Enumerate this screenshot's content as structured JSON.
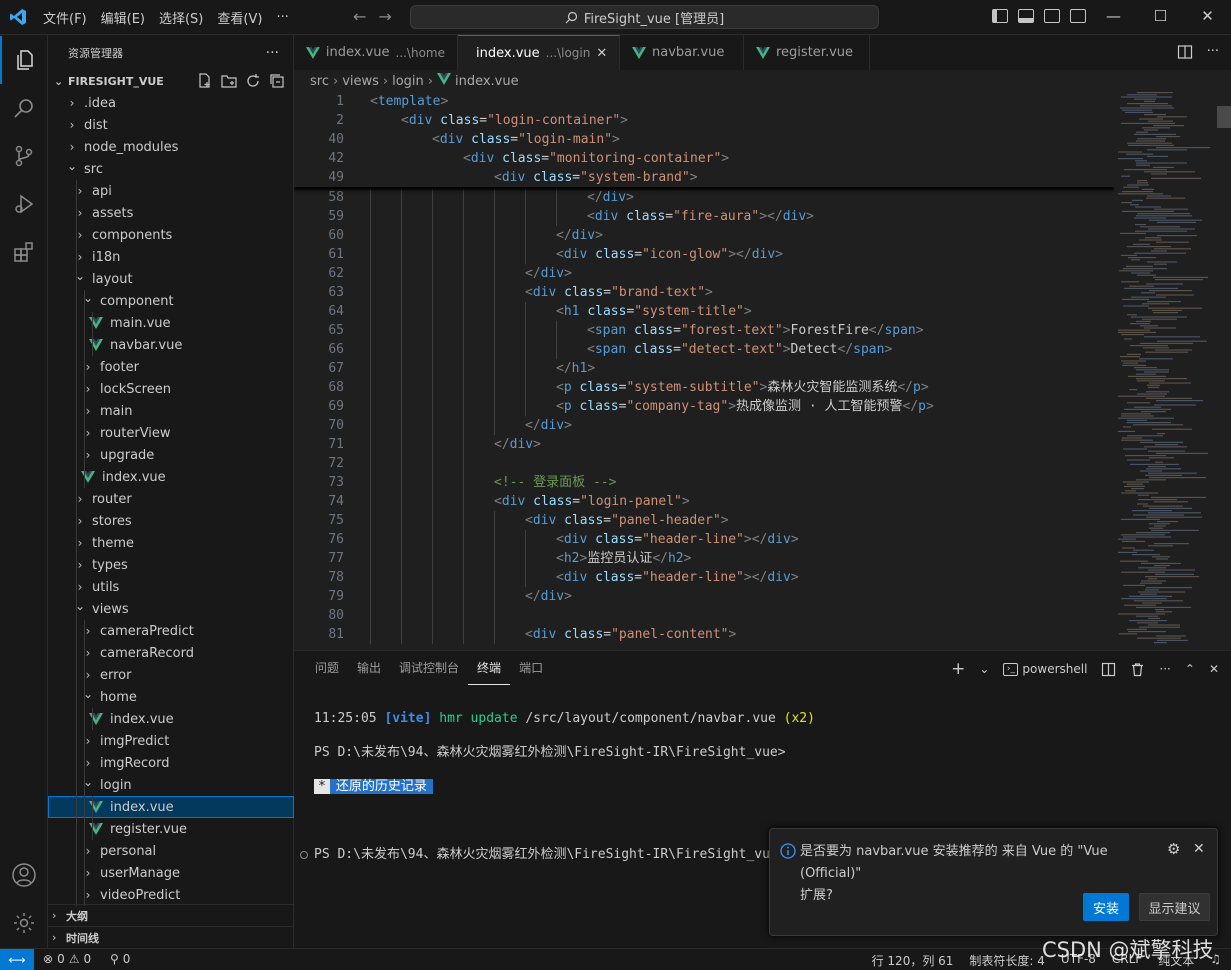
{
  "menu": [
    "文件(F)",
    "编辑(E)",
    "选择(S)",
    "查看(V)",
    "···"
  ],
  "command_center": "FireSight_vue [管理员]",
  "colors": {
    "accent": "#0078d4",
    "vue_green": "#41b883",
    "tag": "#569cd6",
    "attr": "#9cdcfe",
    "string": "#ce9178",
    "comment": "#6a9955"
  },
  "activity_icons": [
    "files-icon",
    "search-icon",
    "source-control-icon",
    "run-debug-icon",
    "extensions-icon",
    "account-icon",
    "settings-gear-icon"
  ],
  "sidebar": {
    "title": "资源管理器",
    "project": "FIRESIGHT_VUE",
    "tree": [
      {
        "label": ".idea",
        "depth": 0,
        "type": "folder",
        "open": false
      },
      {
        "label": "dist",
        "depth": 0,
        "type": "folder",
        "open": false
      },
      {
        "label": "node_modules",
        "depth": 0,
        "type": "folder",
        "open": false
      },
      {
        "label": "src",
        "depth": 0,
        "type": "folder",
        "open": true
      },
      {
        "label": "api",
        "depth": 1,
        "type": "folder",
        "open": false
      },
      {
        "label": "assets",
        "depth": 1,
        "type": "folder",
        "open": false
      },
      {
        "label": "components",
        "depth": 1,
        "type": "folder",
        "open": false
      },
      {
        "label": "i18n",
        "depth": 1,
        "type": "folder",
        "open": false
      },
      {
        "label": "layout",
        "depth": 1,
        "type": "folder",
        "open": true
      },
      {
        "label": "component",
        "depth": 2,
        "type": "folder",
        "open": true
      },
      {
        "label": "main.vue",
        "depth": 3,
        "type": "vue"
      },
      {
        "label": "navbar.vue",
        "depth": 3,
        "type": "vue"
      },
      {
        "label": "footer",
        "depth": 2,
        "type": "folder",
        "open": false
      },
      {
        "label": "lockScreen",
        "depth": 2,
        "type": "folder",
        "open": false
      },
      {
        "label": "main",
        "depth": 2,
        "type": "folder",
        "open": false
      },
      {
        "label": "routerView",
        "depth": 2,
        "type": "folder",
        "open": false
      },
      {
        "label": "upgrade",
        "depth": 2,
        "type": "folder",
        "open": false
      },
      {
        "label": "index.vue",
        "depth": 2,
        "type": "vue"
      },
      {
        "label": "router",
        "depth": 1,
        "type": "folder",
        "open": false
      },
      {
        "label": "stores",
        "depth": 1,
        "type": "folder",
        "open": false
      },
      {
        "label": "theme",
        "depth": 1,
        "type": "folder",
        "open": false
      },
      {
        "label": "types",
        "depth": 1,
        "type": "folder",
        "open": false
      },
      {
        "label": "utils",
        "depth": 1,
        "type": "folder",
        "open": false
      },
      {
        "label": "views",
        "depth": 1,
        "type": "folder",
        "open": true
      },
      {
        "label": "cameraPredict",
        "depth": 2,
        "type": "folder",
        "open": false
      },
      {
        "label": "cameraRecord",
        "depth": 2,
        "type": "folder",
        "open": false
      },
      {
        "label": "error",
        "depth": 2,
        "type": "folder",
        "open": false
      },
      {
        "label": "home",
        "depth": 2,
        "type": "folder",
        "open": true
      },
      {
        "label": "index.vue",
        "depth": 3,
        "type": "vue"
      },
      {
        "label": "imgPredict",
        "depth": 2,
        "type": "folder",
        "open": false
      },
      {
        "label": "imgRecord",
        "depth": 2,
        "type": "folder",
        "open": false
      },
      {
        "label": "login",
        "depth": 2,
        "type": "folder",
        "open": true
      },
      {
        "label": "index.vue",
        "depth": 3,
        "type": "vue",
        "selected": true
      },
      {
        "label": "register.vue",
        "depth": 3,
        "type": "vue"
      },
      {
        "label": "personal",
        "depth": 2,
        "type": "folder",
        "open": false
      },
      {
        "label": "userManage",
        "depth": 2,
        "type": "folder",
        "open": false
      },
      {
        "label": "videoPredict",
        "depth": 2,
        "type": "folder",
        "open": false
      }
    ],
    "sections": [
      "大纲",
      "时间线"
    ]
  },
  "tabs": [
    {
      "label": "index.vue",
      "desc": "...\\home",
      "active": false
    },
    {
      "label": "index.vue",
      "desc": "...\\login",
      "active": true,
      "close": "✕"
    },
    {
      "label": "navbar.vue",
      "desc": "",
      "active": false
    },
    {
      "label": "register.vue",
      "desc": "",
      "active": false
    }
  ],
  "breadcrumb": [
    "src",
    "views",
    "login",
    "index.vue"
  ],
  "sticky_lines": [
    {
      "n": "1",
      "indent": 0,
      "t": "<template>"
    },
    {
      "n": "2",
      "indent": 1,
      "t": "<div class=\"login-container\">"
    },
    {
      "n": "40",
      "indent": 2,
      "t": "<div class=\"login-main\">"
    },
    {
      "n": "42",
      "indent": 3,
      "t": "<div class=\"monitoring-container\">"
    },
    {
      "n": "49",
      "indent": 4,
      "t": "<div class=\"system-brand\">"
    }
  ],
  "code_lines": [
    {
      "n": "58",
      "indent": 7,
      "t": "</div>"
    },
    {
      "n": "59",
      "indent": 7,
      "t": "<div class=\"fire-aura\"></div>"
    },
    {
      "n": "60",
      "indent": 6,
      "t": "</div>"
    },
    {
      "n": "61",
      "indent": 6,
      "t": "<div class=\"icon-glow\"></div>"
    },
    {
      "n": "62",
      "indent": 5,
      "t": "</div>"
    },
    {
      "n": "63",
      "indent": 5,
      "t": "<div class=\"brand-text\">"
    },
    {
      "n": "64",
      "indent": 6,
      "t": "<h1 class=\"system-title\">"
    },
    {
      "n": "65",
      "indent": 7,
      "t": "<span class=\"forest-text\">ForestFire</span>"
    },
    {
      "n": "66",
      "indent": 7,
      "t": "<span class=\"detect-text\">Detect</span>"
    },
    {
      "n": "67",
      "indent": 6,
      "t": "</h1>"
    },
    {
      "n": "68",
      "indent": 6,
      "t": "<p class=\"system-subtitle\">森林火灾智能监测系统</p>"
    },
    {
      "n": "69",
      "indent": 6,
      "t": "<p class=\"company-tag\">热成像监测 · 人工智能预警</p>"
    },
    {
      "n": "70",
      "indent": 5,
      "t": "</div>"
    },
    {
      "n": "71",
      "indent": 4,
      "t": "</div>"
    },
    {
      "n": "72",
      "indent": 4,
      "t": ""
    },
    {
      "n": "73",
      "indent": 4,
      "t": "<!-- 登录面板 -->"
    },
    {
      "n": "74",
      "indent": 4,
      "t": "<div class=\"login-panel\">"
    },
    {
      "n": "75",
      "indent": 5,
      "t": "<div class=\"panel-header\">"
    },
    {
      "n": "76",
      "indent": 6,
      "t": "<div class=\"header-line\"></div>"
    },
    {
      "n": "77",
      "indent": 6,
      "t": "<h2>监控员认证</h2>"
    },
    {
      "n": "78",
      "indent": 6,
      "t": "<div class=\"header-line\"></div>"
    },
    {
      "n": "79",
      "indent": 5,
      "t": "</div>"
    },
    {
      "n": "80",
      "indent": 5,
      "t": ""
    },
    {
      "n": "81",
      "indent": 5,
      "t": "<div class=\"panel-content\">"
    }
  ],
  "panel": {
    "tabs": [
      "问题",
      "输出",
      "调试控制台",
      "终端",
      "端口"
    ],
    "active_tab": "终端",
    "shell": "powershell",
    "terminal": {
      "time": "11:25:05",
      "vite": "[vite]",
      "hmr": "hmr update",
      "path": "/src/layout/component/navbar.vue",
      "count": "(x2)",
      "prompt1": "PS D:\\未发布\\94、森林火灾烟雾红外检测\\FireSight-IR\\FireSight_vue>",
      "restore_star": "*",
      "restore": "还原的历史记录",
      "prompt2": "PS D:\\未发布\\94、森林火灾烟雾红外检测\\FireSight-IR\\FireSight_vue>"
    }
  },
  "toast": {
    "message_line1": "是否要为 navbar.vue 安装推荐的 来自 Vue 的 \"Vue (Official)\"",
    "message_line2": "扩展?",
    "install": "安装",
    "show": "显示建议"
  },
  "status": {
    "errors": "0",
    "warnings": "0",
    "ports": "0",
    "position": "行 120，列 61",
    "indent": "制表符长度: 4",
    "encoding": "UTF-8",
    "eol": "CRLF",
    "lang": "纯文本"
  },
  "watermark": "CSDN @斌擎科技"
}
